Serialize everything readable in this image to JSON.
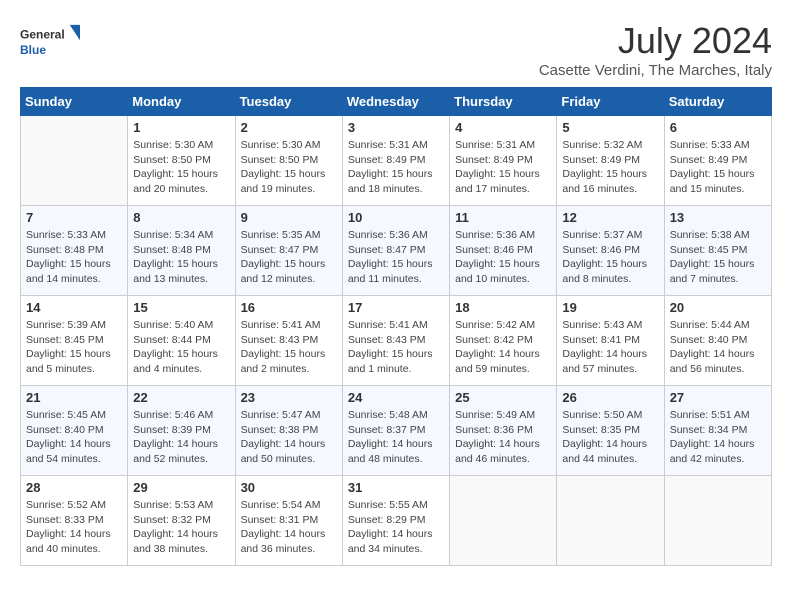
{
  "logo": {
    "general": "General",
    "blue": "Blue"
  },
  "title": "July 2024",
  "subtitle": "Casette Verdini, The Marches, Italy",
  "columns": [
    "Sunday",
    "Monday",
    "Tuesday",
    "Wednesday",
    "Thursday",
    "Friday",
    "Saturday"
  ],
  "weeks": [
    [
      {
        "day": "",
        "info": ""
      },
      {
        "day": "1",
        "info": "Sunrise: 5:30 AM\nSunset: 8:50 PM\nDaylight: 15 hours\nand 20 minutes."
      },
      {
        "day": "2",
        "info": "Sunrise: 5:30 AM\nSunset: 8:50 PM\nDaylight: 15 hours\nand 19 minutes."
      },
      {
        "day": "3",
        "info": "Sunrise: 5:31 AM\nSunset: 8:49 PM\nDaylight: 15 hours\nand 18 minutes."
      },
      {
        "day": "4",
        "info": "Sunrise: 5:31 AM\nSunset: 8:49 PM\nDaylight: 15 hours\nand 17 minutes."
      },
      {
        "day": "5",
        "info": "Sunrise: 5:32 AM\nSunset: 8:49 PM\nDaylight: 15 hours\nand 16 minutes."
      },
      {
        "day": "6",
        "info": "Sunrise: 5:33 AM\nSunset: 8:49 PM\nDaylight: 15 hours\nand 15 minutes."
      }
    ],
    [
      {
        "day": "7",
        "info": "Sunrise: 5:33 AM\nSunset: 8:48 PM\nDaylight: 15 hours\nand 14 minutes."
      },
      {
        "day": "8",
        "info": "Sunrise: 5:34 AM\nSunset: 8:48 PM\nDaylight: 15 hours\nand 13 minutes."
      },
      {
        "day": "9",
        "info": "Sunrise: 5:35 AM\nSunset: 8:47 PM\nDaylight: 15 hours\nand 12 minutes."
      },
      {
        "day": "10",
        "info": "Sunrise: 5:36 AM\nSunset: 8:47 PM\nDaylight: 15 hours\nand 11 minutes."
      },
      {
        "day": "11",
        "info": "Sunrise: 5:36 AM\nSunset: 8:46 PM\nDaylight: 15 hours\nand 10 minutes."
      },
      {
        "day": "12",
        "info": "Sunrise: 5:37 AM\nSunset: 8:46 PM\nDaylight: 15 hours\nand 8 minutes."
      },
      {
        "day": "13",
        "info": "Sunrise: 5:38 AM\nSunset: 8:45 PM\nDaylight: 15 hours\nand 7 minutes."
      }
    ],
    [
      {
        "day": "14",
        "info": "Sunrise: 5:39 AM\nSunset: 8:45 PM\nDaylight: 15 hours\nand 5 minutes."
      },
      {
        "day": "15",
        "info": "Sunrise: 5:40 AM\nSunset: 8:44 PM\nDaylight: 15 hours\nand 4 minutes."
      },
      {
        "day": "16",
        "info": "Sunrise: 5:41 AM\nSunset: 8:43 PM\nDaylight: 15 hours\nand 2 minutes."
      },
      {
        "day": "17",
        "info": "Sunrise: 5:41 AM\nSunset: 8:43 PM\nDaylight: 15 hours\nand 1 minute."
      },
      {
        "day": "18",
        "info": "Sunrise: 5:42 AM\nSunset: 8:42 PM\nDaylight: 14 hours\nand 59 minutes."
      },
      {
        "day": "19",
        "info": "Sunrise: 5:43 AM\nSunset: 8:41 PM\nDaylight: 14 hours\nand 57 minutes."
      },
      {
        "day": "20",
        "info": "Sunrise: 5:44 AM\nSunset: 8:40 PM\nDaylight: 14 hours\nand 56 minutes."
      }
    ],
    [
      {
        "day": "21",
        "info": "Sunrise: 5:45 AM\nSunset: 8:40 PM\nDaylight: 14 hours\nand 54 minutes."
      },
      {
        "day": "22",
        "info": "Sunrise: 5:46 AM\nSunset: 8:39 PM\nDaylight: 14 hours\nand 52 minutes."
      },
      {
        "day": "23",
        "info": "Sunrise: 5:47 AM\nSunset: 8:38 PM\nDaylight: 14 hours\nand 50 minutes."
      },
      {
        "day": "24",
        "info": "Sunrise: 5:48 AM\nSunset: 8:37 PM\nDaylight: 14 hours\nand 48 minutes."
      },
      {
        "day": "25",
        "info": "Sunrise: 5:49 AM\nSunset: 8:36 PM\nDaylight: 14 hours\nand 46 minutes."
      },
      {
        "day": "26",
        "info": "Sunrise: 5:50 AM\nSunset: 8:35 PM\nDaylight: 14 hours\nand 44 minutes."
      },
      {
        "day": "27",
        "info": "Sunrise: 5:51 AM\nSunset: 8:34 PM\nDaylight: 14 hours\nand 42 minutes."
      }
    ],
    [
      {
        "day": "28",
        "info": "Sunrise: 5:52 AM\nSunset: 8:33 PM\nDaylight: 14 hours\nand 40 minutes."
      },
      {
        "day": "29",
        "info": "Sunrise: 5:53 AM\nSunset: 8:32 PM\nDaylight: 14 hours\nand 38 minutes."
      },
      {
        "day": "30",
        "info": "Sunrise: 5:54 AM\nSunset: 8:31 PM\nDaylight: 14 hours\nand 36 minutes."
      },
      {
        "day": "31",
        "info": "Sunrise: 5:55 AM\nSunset: 8:29 PM\nDaylight: 14 hours\nand 34 minutes."
      },
      {
        "day": "",
        "info": ""
      },
      {
        "day": "",
        "info": ""
      },
      {
        "day": "",
        "info": ""
      }
    ]
  ]
}
